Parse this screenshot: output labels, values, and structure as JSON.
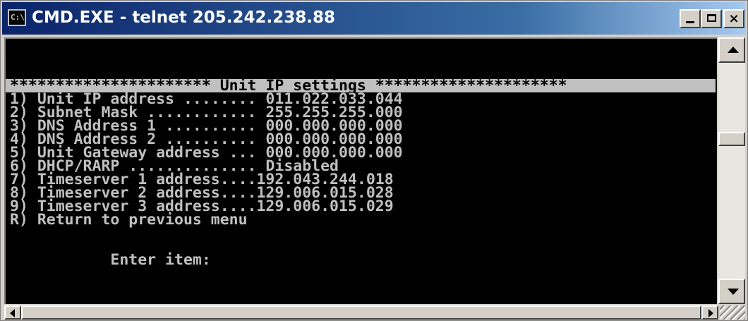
{
  "window": {
    "title": "CMD.EXE - telnet 205.242.238.88",
    "icon_label": "C:\\",
    "icon": "cmd-icon",
    "controls": {
      "minimize": "minimize-icon",
      "maximize": "maximize-icon",
      "close_label": "×"
    }
  },
  "colors": {
    "titlebar_start": "#0a246a",
    "titlebar_end": "#a6caf0",
    "console_bg": "#000000",
    "console_fg": "#c0c0c0",
    "highlight_bg": "#c0c0c0"
  },
  "console": {
    "lines": [
      "",
      "",
      "",
      "********************** Unit IP settings *********************",
      "1) Unit IP address ........ 011.022.033.044",
      "2) Subnet Mask ............ 255.255.255.000",
      "3) DNS Address 1 .......... 000.000.000.000",
      "4) DNS Address 2 .......... 000.000.000.000",
      "5) Unit Gateway address ... 000.000.000.000",
      "6) DHCP/RARP .............. Disabled",
      "7) Timeserver 1 address....192.043.244.018",
      "8) Timeserver 2 address....129.006.015.028",
      "9) Timeserver 3 address....129.006.015.029",
      "R) Return to previous menu",
      "",
      "",
      "           Enter item:"
    ],
    "highlighted_line": 3
  }
}
